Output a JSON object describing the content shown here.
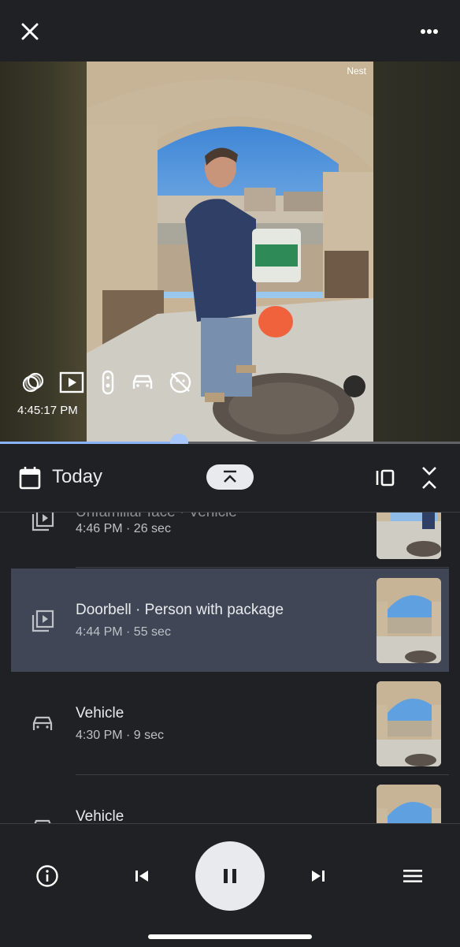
{
  "camera": {
    "brand_label": "Nest",
    "timestamp": "4:45:17 PM",
    "playback_progress": 0.39,
    "overlay_icons": [
      "activity-zones-icon",
      "video-clip-icon",
      "doorbell-icon",
      "vehicle-icon",
      "face-off-icon"
    ]
  },
  "date_bar": {
    "label": "Today"
  },
  "events": [
    {
      "title": "Unfamiliar face · Vehicle",
      "meta": "4:46 PM · 26 sec",
      "icon": "video-clip-icon",
      "selected": false
    },
    {
      "title": "Doorbell · Person with package",
      "meta": "4:44 PM · 55 sec",
      "icon": "video-clip-icon",
      "selected": true
    },
    {
      "title": "Vehicle",
      "meta": "4:30 PM · 9 sec",
      "icon": "vehicle-icon",
      "selected": false
    },
    {
      "title": "Vehicle",
      "meta": "",
      "icon": "vehicle-icon",
      "selected": false
    }
  ],
  "bottom_controls": [
    "info-icon",
    "skip-previous-icon",
    "pause-icon",
    "skip-next-icon",
    "menu-icon"
  ],
  "colors": {
    "accent": "#8ab4f8",
    "background": "#202124",
    "selected_row": "#414656"
  }
}
